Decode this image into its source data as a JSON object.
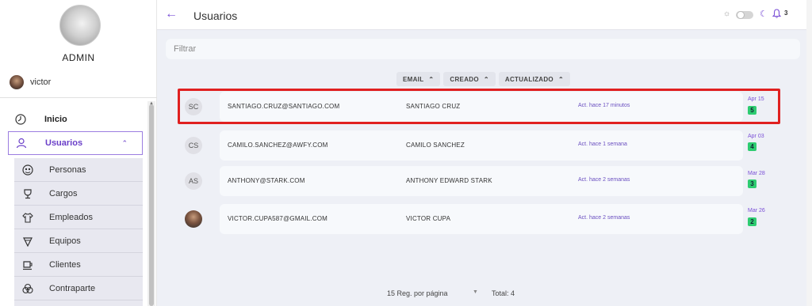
{
  "sidebar": {
    "role": "ADMIN",
    "user": "victor",
    "nav": [
      {
        "label": "Inicio",
        "icon": "dashboard-icon"
      },
      {
        "label": "Usuarios",
        "icon": "user-icon"
      }
    ],
    "submenu": [
      {
        "label": "Personas",
        "icon": "people-icon"
      },
      {
        "label": "Cargos",
        "icon": "trophy-icon"
      },
      {
        "label": "Empleados",
        "icon": "shirt-icon"
      },
      {
        "label": "Equipos",
        "icon": "team-icon"
      },
      {
        "label": "Clientes",
        "icon": "cup-icon"
      },
      {
        "label": "Contraparte",
        "icon": "circles-icon"
      }
    ]
  },
  "header": {
    "title": "Usuarios",
    "notifications": "3"
  },
  "filter": {
    "placeholder": "Filtrar"
  },
  "sorts": [
    {
      "label": "EMAIL"
    },
    {
      "label": "CREADO"
    },
    {
      "label": "ACTUALIZADO"
    }
  ],
  "users": [
    {
      "initials": "SC",
      "email": "SANTIAGO.CRUZ@SANTIAGO.COM",
      "name": "SANTIAGO CRUZ",
      "updated": "Act. hace 17 minutos",
      "date": "Apr 15",
      "count": "5"
    },
    {
      "initials": "CS",
      "email": "CAMILO.SANCHEZ@AWFY.COM",
      "name": "CAMILO SANCHEZ",
      "updated": "Act. hace 1 semana",
      "date": "Apr 03",
      "count": "4"
    },
    {
      "initials": "AS",
      "email": "ANTHONY@STARK.COM",
      "name": "ANTHONY EDWARD STARK",
      "updated": "Act. hace 2 semanas",
      "date": "Mar 28",
      "count": "3"
    },
    {
      "initials": "",
      "email": "VICTOR.CUPA587@GMAIL.COM",
      "name": "VICTOR CUPA",
      "updated": "Act. hace 2 semanas",
      "date": "Mar 26",
      "count": "2"
    }
  ],
  "pagination": {
    "per_page": "15 Reg. por página",
    "total": "Total: 4"
  },
  "colors": {
    "accent": "#7a4fd6",
    "highlight": "#e02020",
    "badge": "#2ecc71"
  }
}
